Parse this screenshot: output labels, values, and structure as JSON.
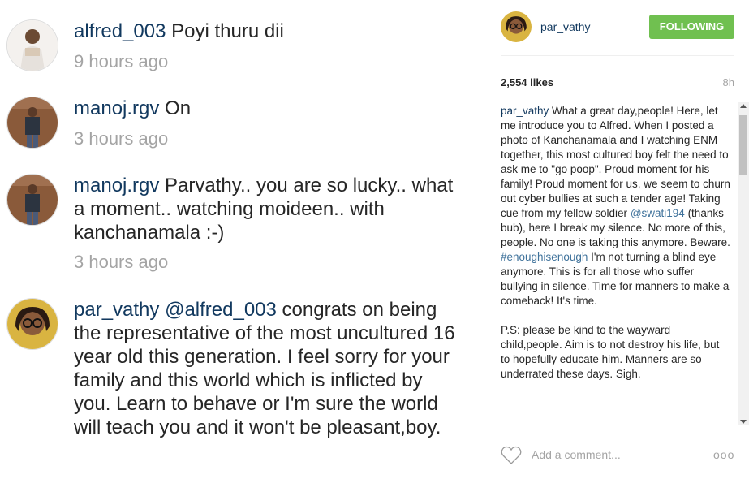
{
  "comments": [
    {
      "username": "alfred_003",
      "text": "Poyi thuru dii",
      "time": "9 hours ago"
    },
    {
      "username": "manoj.rgv",
      "text": "On",
      "time": "3 hours ago"
    },
    {
      "username": "manoj.rgv",
      "text": "Parvathy.. you are so lucky.. what a moment.. watching moideen.. with kanchanamala :-)",
      "time": "3 hours ago"
    },
    {
      "username": "par_vathy",
      "mention": "@alfred_003",
      "text": "congrats on being the representative of the most uncultured 16 year old this generation. I feel sorry for your family and this world which is inflicted by you. Learn to behave or I'm sure the world will teach you and it won't be pleasant,boy.",
      "time": ""
    }
  ],
  "post": {
    "username": "par_vathy",
    "follow_label": "FOLLOWING",
    "likes": "2,554 likes",
    "age": "8h",
    "caption_user": "par_vathy",
    "caption_part1": " What a great day,people! Here, let me introduce you to Alfred. When I posted a photo of Kanchanamala and I watching ENM together, this most cultured boy felt the need to ask me to \"go poop\". Proud moment for his family! Proud moment for us, we seem to churn out cyber bullies at such a tender age! Taking cue from my fellow soldier ",
    "mention": "@swati194",
    "caption_part2": " (thanks bub), here I break my silence. No more of this, people. No one is taking this anymore. Beware. ",
    "hashtag": "#enoughisenough",
    "caption_part3": " I'm not turning a blind eye anymore. This is for all those who suffer bullying in silence. Time for manners to make a comeback! It's time.\n\nP.S: please be kind to the wayward child,people. Aim is to not destroy his life, but to hopefully educate him. Manners are so underrated these days. Sigh.",
    "add_comment_placeholder": "Add a comment...",
    "more_label": "ooo"
  },
  "icons": {
    "heart": "heart-icon",
    "more": "more-options-icon"
  },
  "colors": {
    "follow_green": "#70c050",
    "username_blue": "#12395f",
    "link_blue": "#3f729b",
    "muted_gray": "#a4a4a4"
  }
}
